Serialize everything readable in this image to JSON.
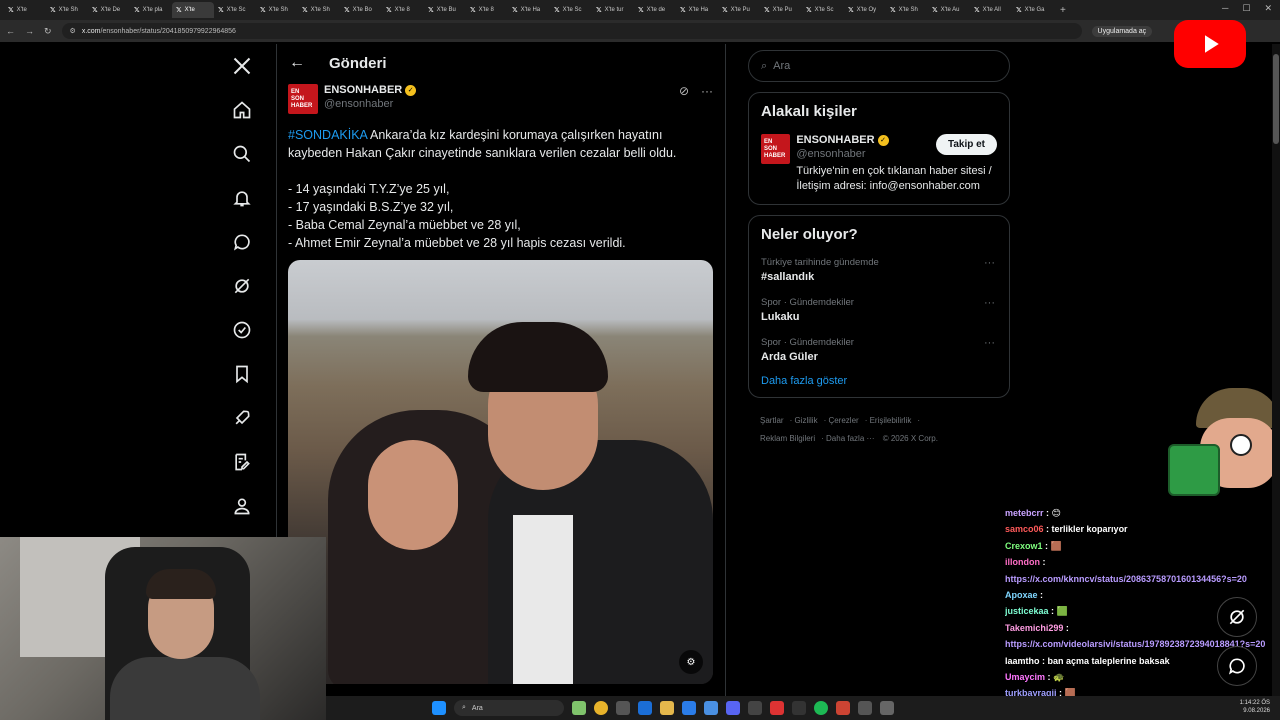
{
  "browser": {
    "tabs": [
      "X'te",
      "X'te Sh",
      "X'te De",
      "X'te pla",
      "X'te",
      "X'te Sc",
      "X'te Sh",
      "X'te Sh",
      "X'te Bo",
      "X'te 8",
      "X'te Bu",
      "X'te 8",
      "X'te Ha",
      "X'te Sc",
      "X'te tur",
      "X'te de",
      "X'te Ha",
      "X'te Pu",
      "X'te Pu",
      "X'te Sc",
      "X'te Oy",
      "X'te Sh",
      "X'te Au",
      "X'te All",
      "X'te Ga"
    ],
    "url_domain": "x.com",
    "url_path": "/ensonhaber/status/2041850979922964856",
    "app_chip": "Uygulamada aç"
  },
  "page": {
    "header_title": "Gönderi",
    "author": {
      "name": "ENSONHABER",
      "handle": "@ensonhaber",
      "logo_lines": [
        "EN",
        "SON",
        "HABER"
      ]
    },
    "tweet": {
      "hashtag": "#SONDAKİKA",
      "line1": " Ankara’da kız kardeşini korumaya çalışırken hayatını kaybeden Hakan Çakır cinayetinde sanıklara verilen cezalar belli oldu.",
      "items": [
        "- 14 yaşındaki T.Y.Z’ye 25 yıl,",
        "- 17 yaşındaki B.S.Z’ye 32 yıl,",
        "- Baba Cemal Zeynal’a müebbet ve 28 yıl,",
        "- Ahmet Emir Zeynal’a müebbet ve 28 yıl hapis cezası verildi."
      ]
    }
  },
  "sidebar": {
    "search_placeholder": "Ara",
    "related": {
      "title": "Alakalı kişiler",
      "name": "ENSONHABER",
      "handle": "@ensonhaber",
      "bio": "Türkiye'nin en çok tıklanan haber sitesi / İletişim adresi: info@ensonhaber.com",
      "follow_label": "Takip et"
    },
    "trends": {
      "title": "Neler oluyor?",
      "items": [
        {
          "meta": "Türkiye tarihinde gündemde",
          "name": "#sallandık"
        },
        {
          "meta": "Spor · Gündemdekiler",
          "name": "Lukaku"
        },
        {
          "meta": "Spor · Gündemdekiler",
          "name": "Arda Güler"
        }
      ],
      "show_more": "Daha fazla göster"
    },
    "footer": [
      "Şartlar",
      "Gizlilik",
      "Çerezler",
      "Erişilebilirlik",
      "Reklam Bilgileri",
      "Daha fazla ···",
      "© 2026 X Corp."
    ]
  },
  "chat": [
    {
      "user": "metebcrr",
      "color": "#c9a3ff",
      "msg": " : 😊"
    },
    {
      "user": "samco06",
      "color": "#ff5a5a",
      "msg": " : terlikler koparıyor"
    },
    {
      "user": "Crexow1",
      "color": "#7fff7f",
      "msg": " : 🟫"
    },
    {
      "user": "illondon",
      "color": "#ff6ec7",
      "msg": " :"
    },
    {
      "user": "",
      "color": "#b99cff",
      "msg": "https://x.com/kknncv/status/2086375870160134456?s=20",
      "link": true
    },
    {
      "user": "Apoxae",
      "color": "#7fd6ff",
      "msg": " :"
    },
    {
      "user": "justicekaa",
      "color": "#7fffd4",
      "msg": " : 🟩"
    },
    {
      "user": "Takemichi299",
      "color": "#ff9de2",
      "msg": " :"
    },
    {
      "user": "",
      "color": "#b99cff",
      "msg": "https://x.com/videolarsivi/status/1978923872394018841?s=20",
      "link": true
    },
    {
      "user": "laamtho",
      "color": "#ffffff",
      "msg": " : ban açma taleplerine baksak"
    },
    {
      "user": "Umaycim",
      "color": "#ff77ff",
      "msg": " : 🐢"
    },
    {
      "user": "turkbayragii",
      "color": "#a0a0ff",
      "msg": " : 🟫"
    }
  ],
  "taskbar": {
    "search": "Ara",
    "time": "1:14:22 ÖS",
    "date": "9.08.2026"
  },
  "colors": {
    "accent": "#1d9bf0",
    "verified": "#f4c01e",
    "brand_red": "#c4161c"
  }
}
